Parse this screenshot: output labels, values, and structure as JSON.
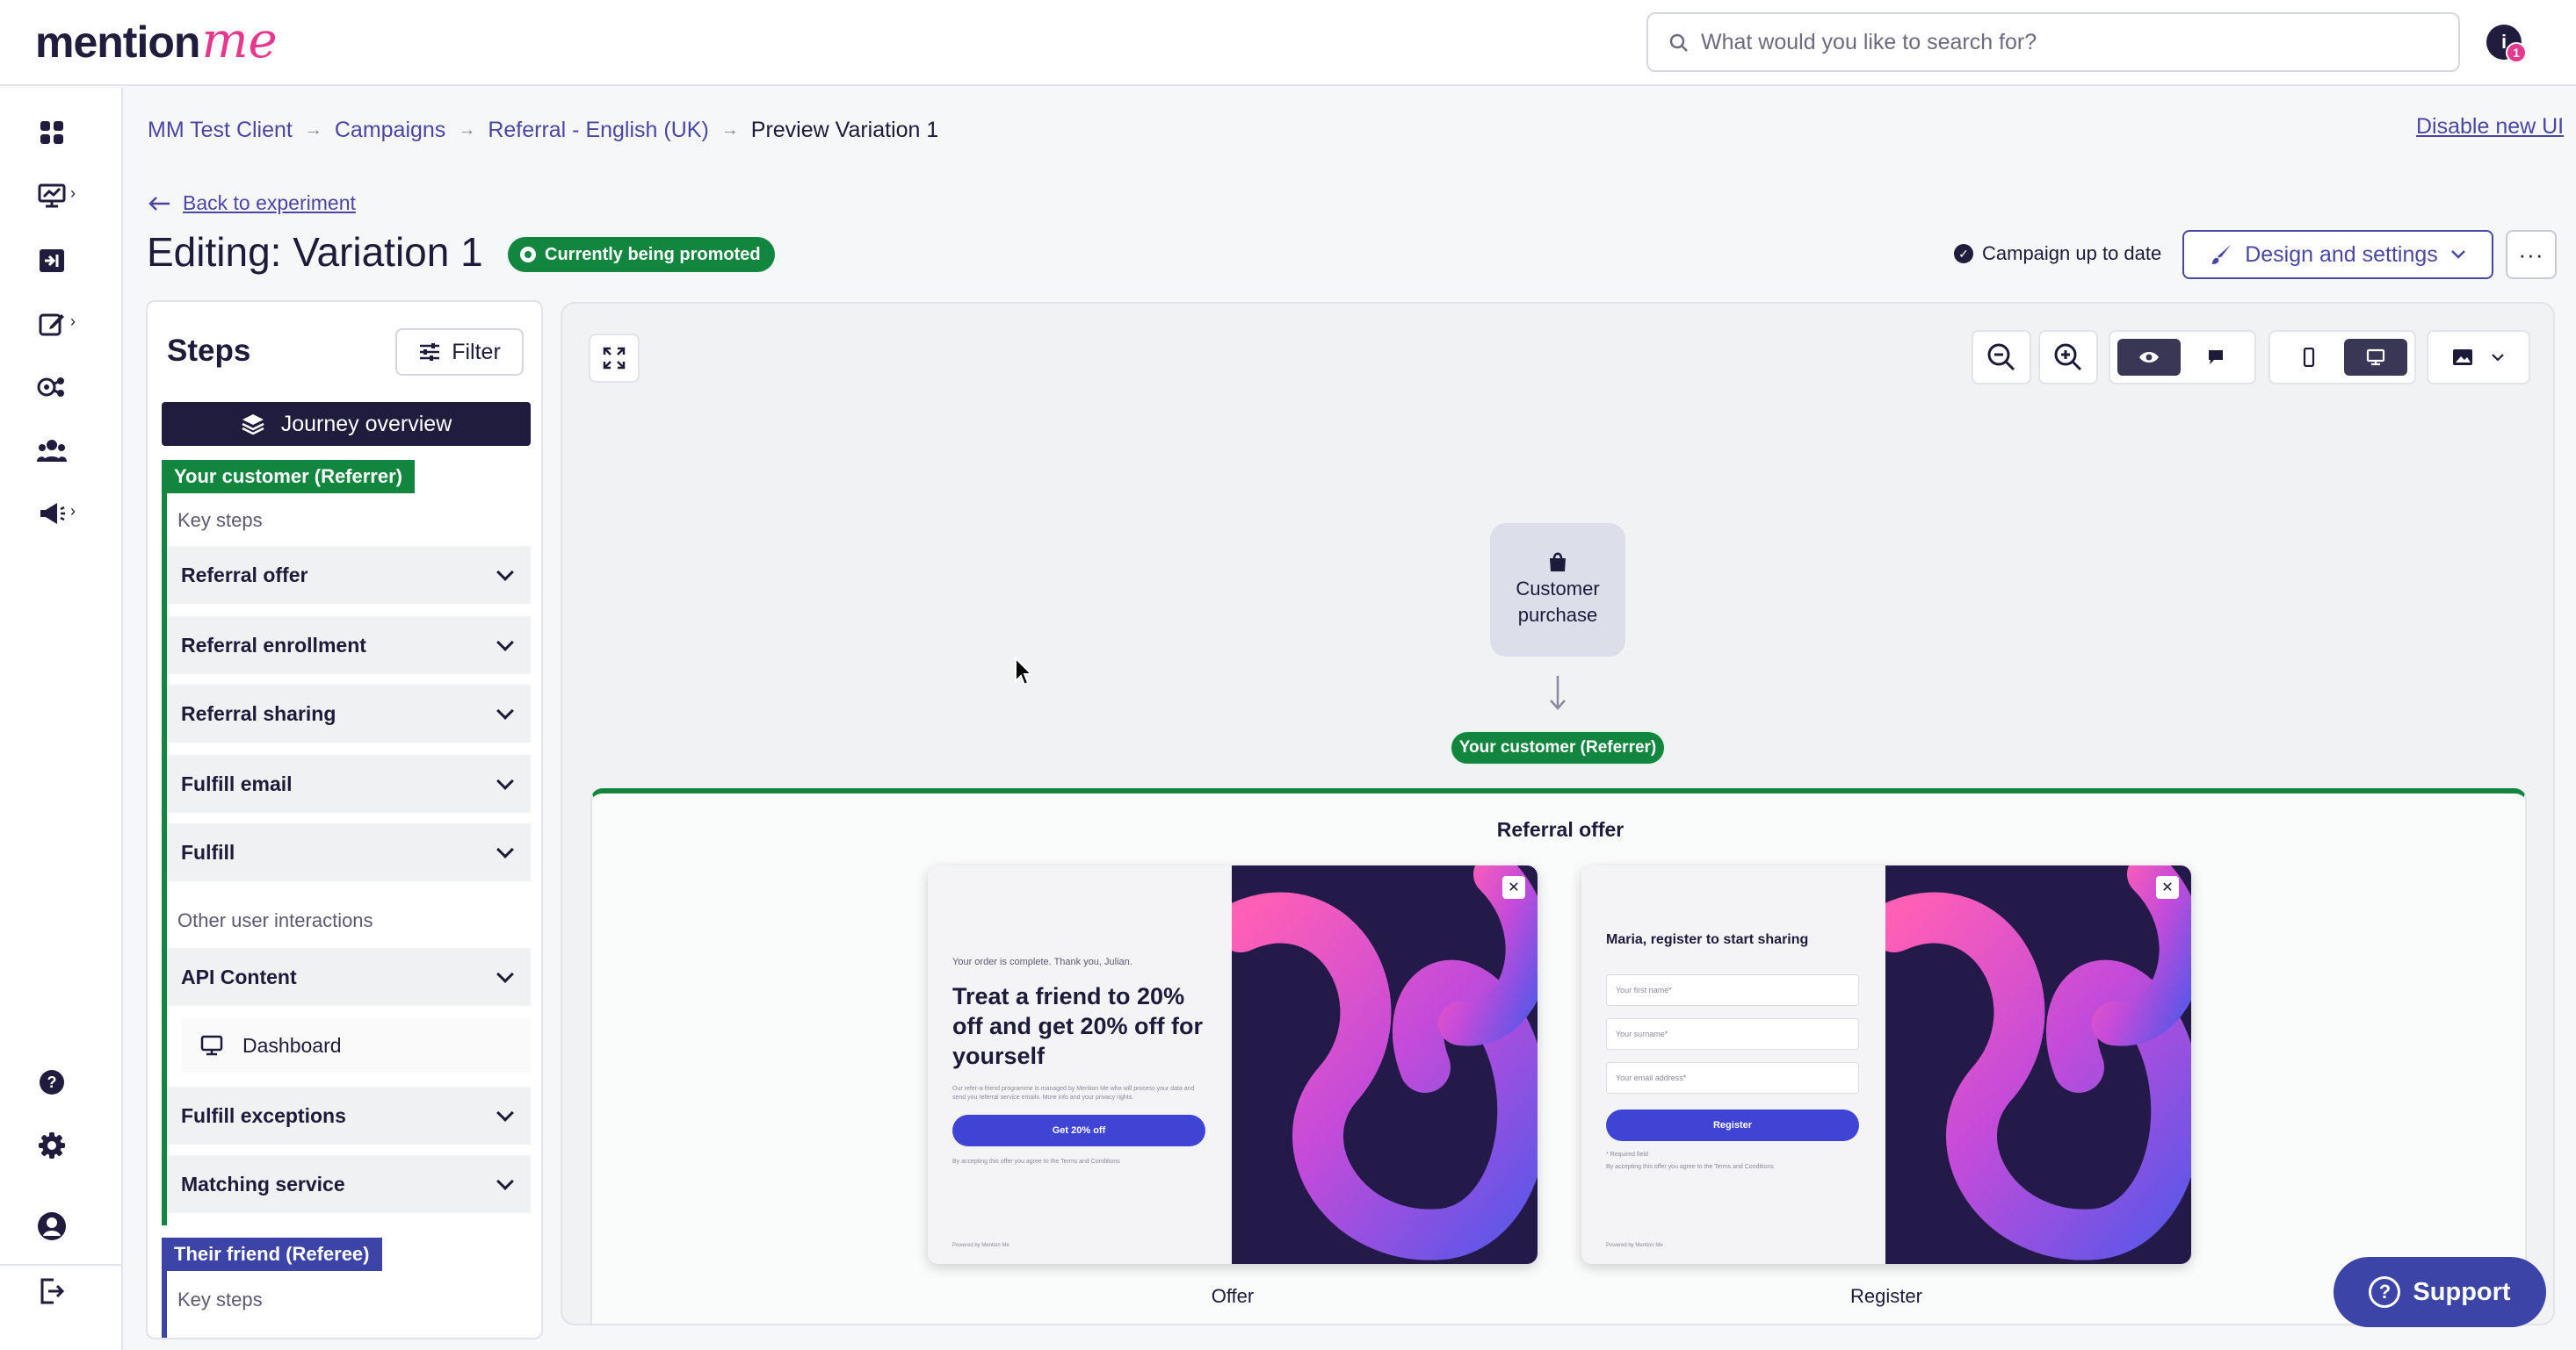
{
  "header": {
    "logo_main": "mention",
    "logo_accent": "me",
    "search_placeholder": "What would you like to search for?",
    "notif_letter": "i",
    "notif_count": "1"
  },
  "rail": {
    "icons": [
      "dashboard-icon",
      "analytics-icon",
      "campaigns-icon",
      "edit-icon",
      "integrations-icon",
      "users-icon",
      "announcements-icon",
      "help-icon",
      "settings-icon",
      "account-icon",
      "logout-icon"
    ]
  },
  "breadcrumb": {
    "items": [
      "MM Test Client",
      "Campaigns",
      "Referral - English (UK)"
    ],
    "current": "Preview Variation 1"
  },
  "disable_ui": "Disable new UI",
  "back_label": "Back to experiment",
  "page_title": "Editing: Variation 1",
  "promo_badge": "Currently being promoted",
  "campaign_status": "Campaign up to date",
  "design_button": "Design and settings",
  "more_button": "···",
  "steps": {
    "title": "Steps",
    "filter_label": "Filter",
    "journey_label": "Journey overview",
    "referrer_tag": "Your customer (Referrer)",
    "key_steps_label": "Key steps",
    "key_steps": [
      "Referral offer",
      "Referral enrollment",
      "Referral sharing",
      "Fulfill email",
      "Fulfill"
    ],
    "other_label": "Other user interactions",
    "other_steps": [
      "API Content",
      "Fulfill exceptions",
      "Matching service"
    ],
    "dashboard_label": "Dashboard",
    "referee_tag": "Their friend (Referee)",
    "referee_key_steps_label": "Key steps"
  },
  "canvas": {
    "node_label_1": "Customer",
    "node_label_2": "purchase",
    "referrer_pill": "Your customer (Referrer)",
    "offer_heading": "Referral offer",
    "cards": [
      {
        "caption": "Offer",
        "small_intro": "Your order is complete. Thank you, Julian.",
        "headline": "Treat a friend to 20% off and get 20% off for yourself",
        "fine_print": "Our refer-a-friend programme is managed by Mention Me who will process your data and send you referral service emails. More info and your privacy rights.",
        "cta": "Get 20% off",
        "terms": "By accepting this offer you agree to the Terms and Conditions",
        "powered": "Powered by Mention Me"
      },
      {
        "caption": "Register",
        "headline": "Maria, register to start sharing",
        "field_1": "Your first name*",
        "field_2": "Your surname*",
        "field_3": "Your email address*",
        "cta": "Register",
        "required_note": "* Required field",
        "terms": "By accepting this offer you agree to the Terms and Conditions",
        "powered": "Powered by Mention Me"
      }
    ]
  },
  "support_label": "Support",
  "colors": {
    "brand_dark": "#1f1c3d",
    "brand_pink": "#e6398e",
    "link": "#4a47a3",
    "referrer_green": "#12863f",
    "referee_blue": "#3c44a8",
    "cta_blue": "#3f44d4"
  }
}
